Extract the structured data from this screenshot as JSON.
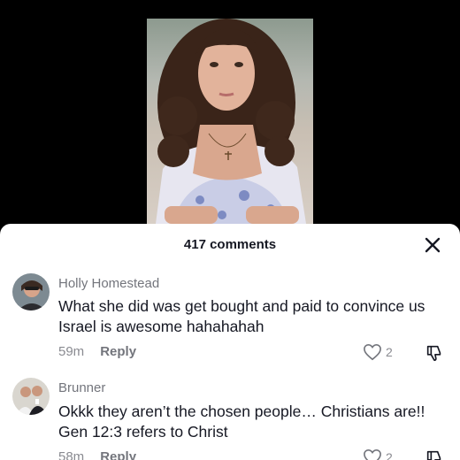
{
  "sheet": {
    "comment_count": "417 comments"
  },
  "comments": [
    {
      "username": "Holly Homestead",
      "text": "What she did was get bought and paid to convince us Israel is awesome hahahahah",
      "age": "59m",
      "reply_label": "Reply",
      "likes": "2"
    },
    {
      "username": "Brunner",
      "text": "Okkk they aren’t the chosen people… Christians are!! Gen 12:3 refers to Christ",
      "age": "58m",
      "reply_label": "Reply",
      "likes": "2"
    }
  ],
  "colors": {
    "text_primary": "#161823",
    "text_secondary": "#73757c",
    "sheet_bg": "#ffffff",
    "backdrop": "#000000"
  }
}
